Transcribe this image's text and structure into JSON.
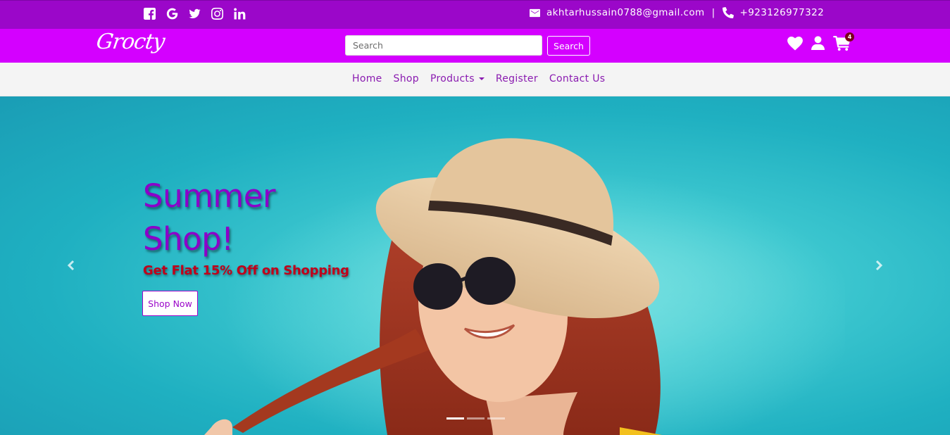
{
  "topbar": {
    "social_icons": [
      "facebook-icon",
      "google-icon",
      "twitter-icon",
      "instagram-icon",
      "linkedin-icon"
    ],
    "email": "akhtarhussain0788@gmail.com",
    "separator": "|",
    "phone": "+923126977322",
    "background": "#9b07c9"
  },
  "brandbar": {
    "logo": "Grocty",
    "search": {
      "placeholder": "Search",
      "value": ""
    },
    "search_button": "Search",
    "icons": [
      "heart-icon",
      "user-icon",
      "cart-icon"
    ],
    "cart_count": "4",
    "background": "#d400ff"
  },
  "nav": {
    "items": [
      {
        "label": "Home"
      },
      {
        "label": "Shop"
      },
      {
        "label": "Products"
      },
      {
        "label": "Register"
      },
      {
        "label": "Contact Us"
      }
    ],
    "link_color": "#8a1bb0"
  },
  "hero": {
    "title_line1": "Summer",
    "title_line2": "Shop!",
    "subtitle": "Get Flat 15% Off on Shopping",
    "button": "Shop Now",
    "title_color": "#8b00c9",
    "subtitle_color": "#c0001a",
    "slides": 3,
    "active_slide": 1,
    "arrows": [
      "chevron-left-icon",
      "chevron-right-icon"
    ]
  }
}
